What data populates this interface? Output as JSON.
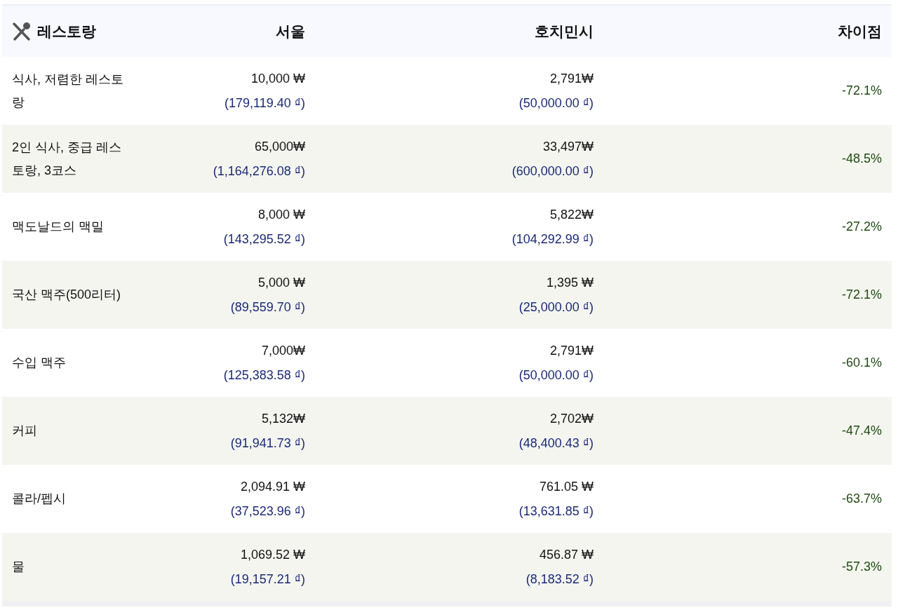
{
  "table": {
    "title": "레스토랑",
    "columns": [
      "서울",
      "호치민시",
      "차이점"
    ],
    "rows": [
      {
        "item": "식사, 저렴한 레스토랑",
        "seoul": {
          "krw": "10,000 ₩",
          "vnd": "(179,119.40 ₫)"
        },
        "hcmc": {
          "krw": "2,791₩",
          "vnd": "(50,000.00 ₫)"
        },
        "difference": "-72.1%"
      },
      {
        "item": "2인 식사, 중급 레스토랑, 3코스",
        "seoul": {
          "krw": "65,000₩",
          "vnd": "(1,164,276.08 ₫)"
        },
        "hcmc": {
          "krw": "33,497₩",
          "vnd": "(600,000.00 ₫)"
        },
        "difference": "-48.5%"
      },
      {
        "item": "맥도날드의 맥밀",
        "seoul": {
          "krw": "8,000 ₩",
          "vnd": "(143,295.52 ₫)"
        },
        "hcmc": {
          "krw": "5,822₩",
          "vnd": "(104,292.99 ₫)"
        },
        "difference": "-27.2%"
      },
      {
        "item": "국산 맥주(500리터)",
        "seoul": {
          "krw": "5,000 ₩",
          "vnd": "(89,559.70 ₫)"
        },
        "hcmc": {
          "krw": "1,395 ₩",
          "vnd": "(25,000.00 ₫)"
        },
        "difference": "-72.1%"
      },
      {
        "item": "수입 맥주",
        "seoul": {
          "krw": "7,000₩",
          "vnd": "(125,383.58 ₫)"
        },
        "hcmc": {
          "krw": "2,791₩",
          "vnd": "(50,000.00 ₫)"
        },
        "difference": "-60.1%"
      },
      {
        "item": "커피",
        "seoul": {
          "krw": "5,132₩",
          "vnd": "(91,941.73 ₫)"
        },
        "hcmc": {
          "krw": "2,702₩",
          "vnd": "(48,400.43 ₫)"
        },
        "difference": "-47.4%"
      },
      {
        "item": "콜라/펩시",
        "seoul": {
          "krw": "2,094.91 ₩",
          "vnd": "(37,523.96 ₫)"
        },
        "hcmc": {
          "krw": "761.05 ₩",
          "vnd": "(13,631.85 ₫)"
        },
        "difference": "-63.7%"
      },
      {
        "item": "물",
        "seoul": {
          "krw": "1,069.52 ₩",
          "vnd": "(19,157.21 ₫)"
        },
        "hcmc": {
          "krw": "456.87 ₩",
          "vnd": "(8,183.52 ₫)"
        },
        "difference": "-57.3%"
      }
    ]
  }
}
